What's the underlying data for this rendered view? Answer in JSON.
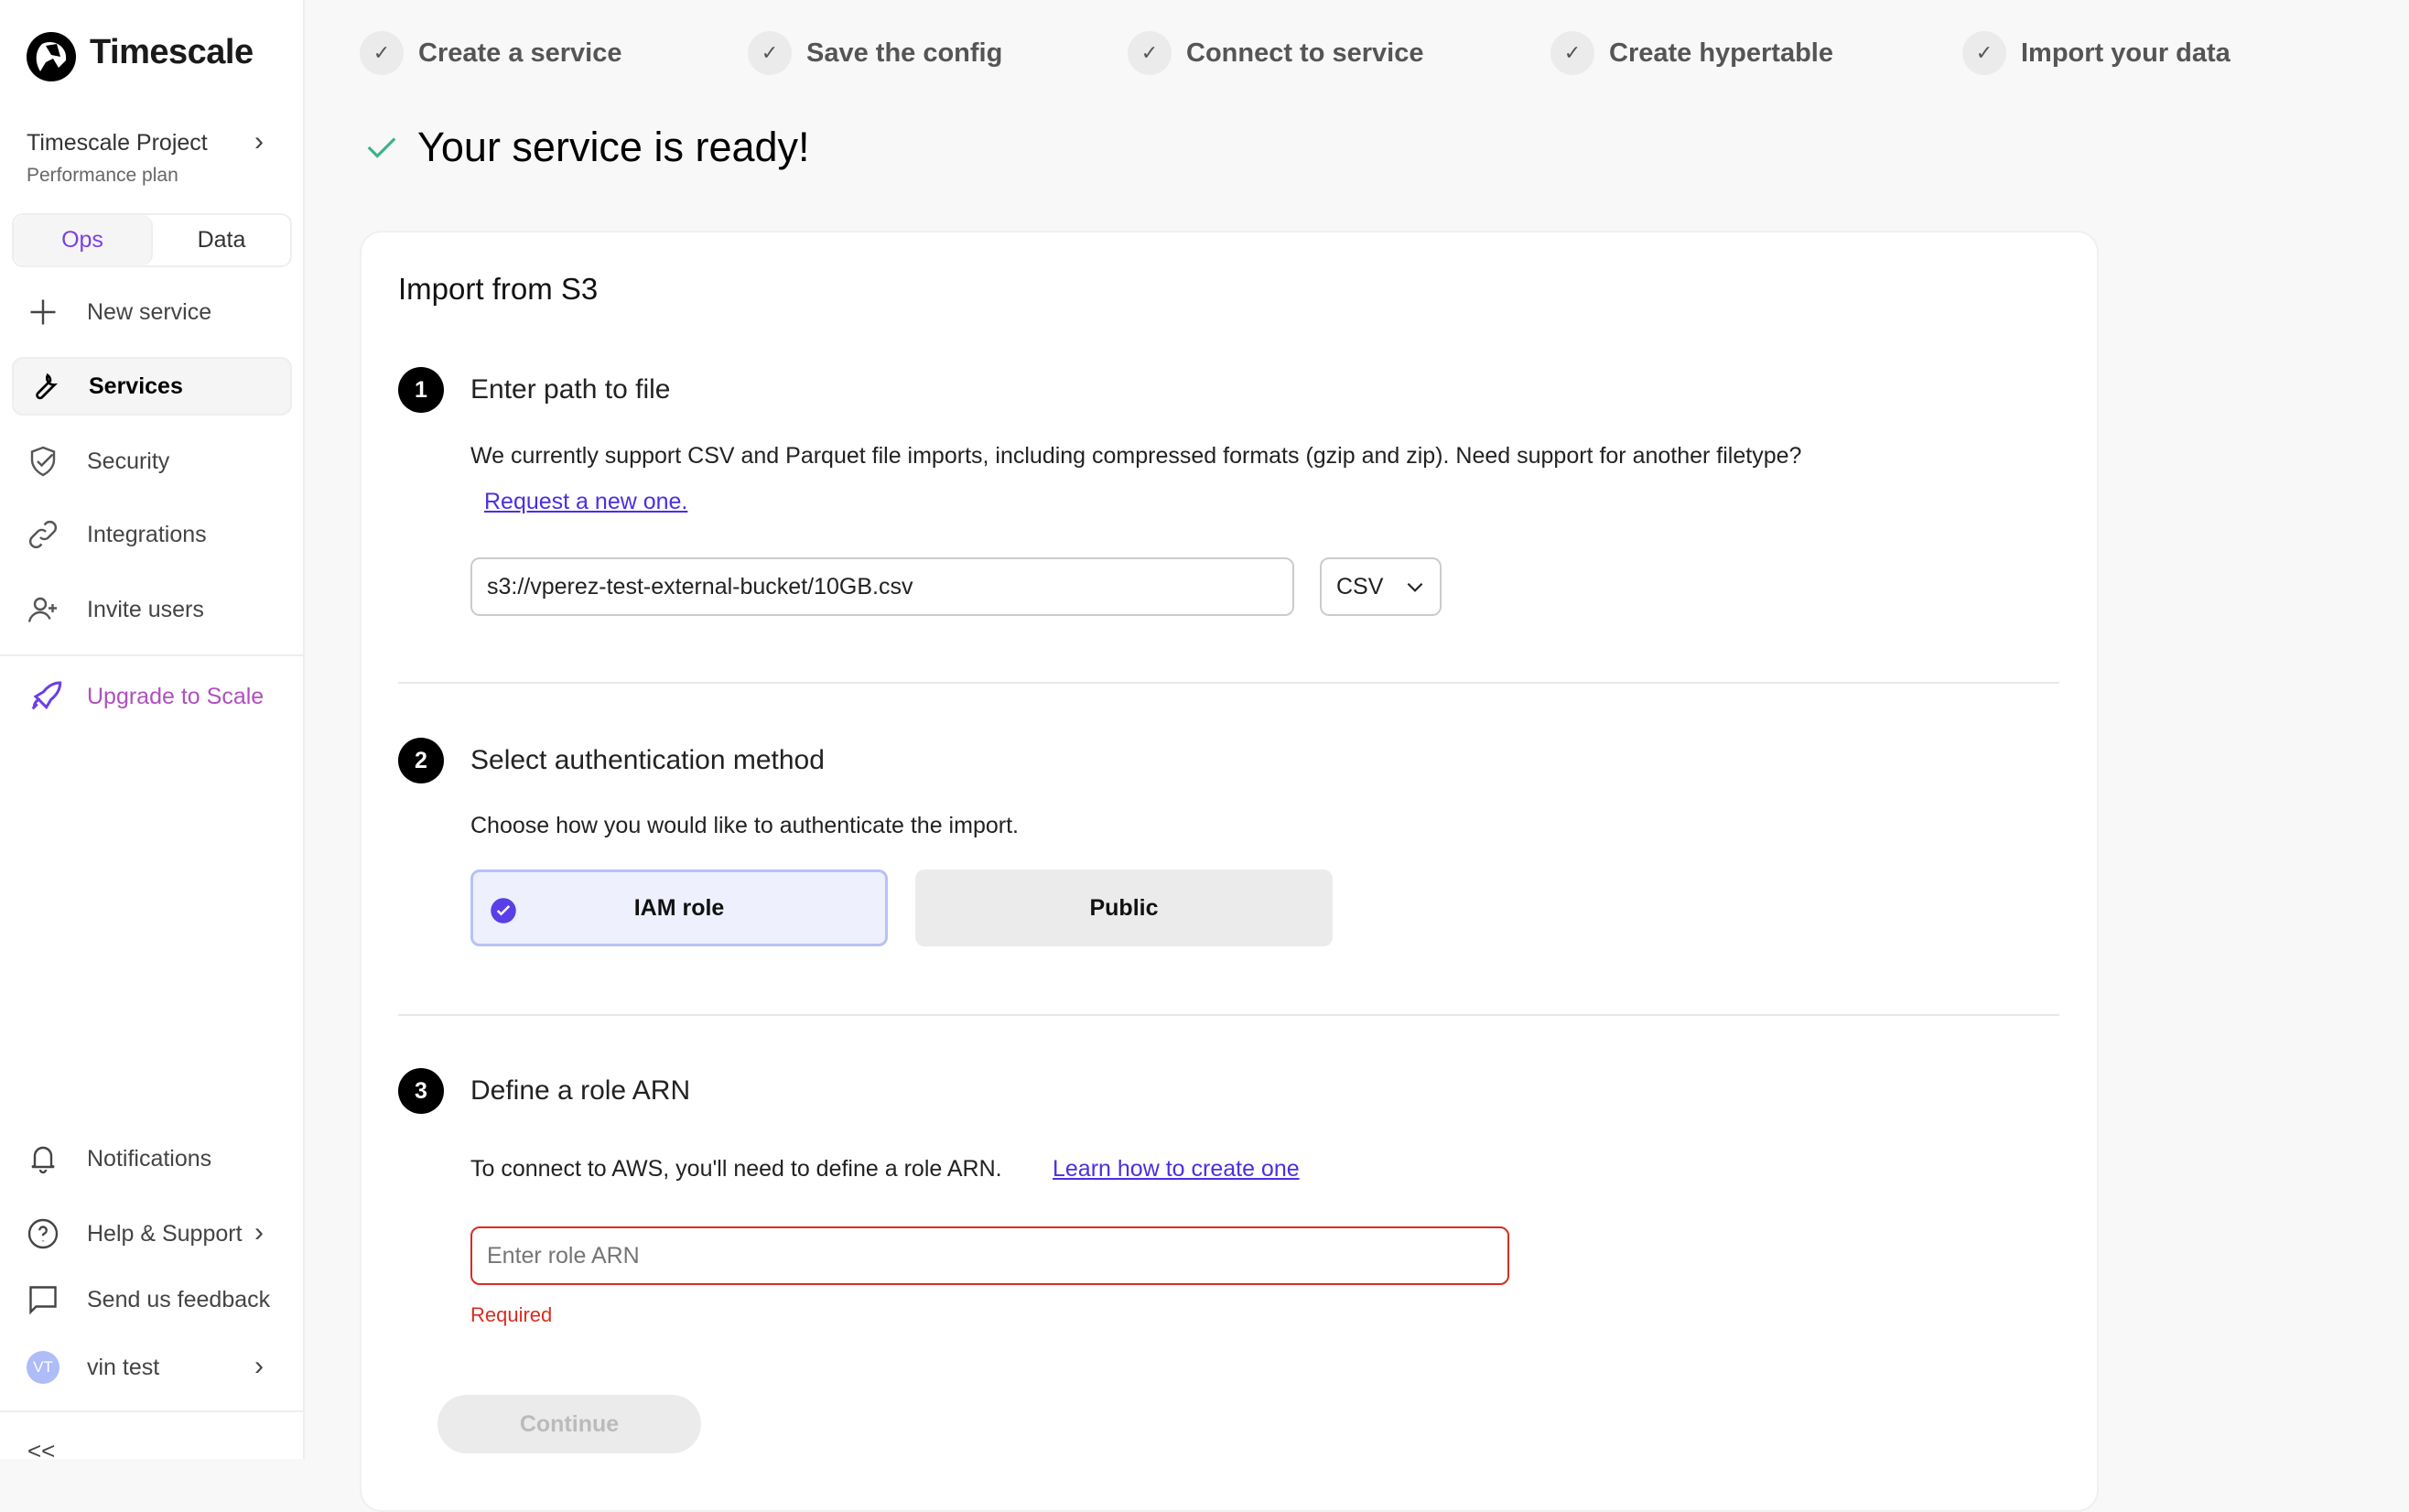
{
  "sidebar": {
    "brand": "Timescale",
    "project": {
      "title": "Timescale Project",
      "plan": "Performance plan"
    },
    "tabs": [
      {
        "label": "Ops",
        "active": true
      },
      {
        "label": "Data",
        "active": false
      }
    ],
    "items": [
      {
        "label": "New service",
        "icon": "plus-icon"
      },
      {
        "label": "Services",
        "icon": "wrench-icon",
        "active": true
      },
      {
        "label": "Security",
        "icon": "shield-check-icon"
      },
      {
        "label": "Integrations",
        "icon": "link-icon"
      },
      {
        "label": "Invite users",
        "icon": "user-plus-icon"
      }
    ],
    "upgrade": "Upgrade to Scale",
    "bottom": [
      {
        "label": "Notifications",
        "icon": "bell-icon"
      },
      {
        "label": "Help & Support",
        "icon": "help-circle-icon"
      },
      {
        "label": "Send us feedback",
        "icon": "message-icon"
      }
    ],
    "user": {
      "initials": "VT",
      "name": "vin test"
    },
    "collapse": "<<"
  },
  "steps": [
    {
      "label": "Create a service"
    },
    {
      "label": "Save the config"
    },
    {
      "label": "Connect to service"
    },
    {
      "label": "Create hypertable"
    },
    {
      "label": "Import your data"
    }
  ],
  "ready_title": "Your service is ready!",
  "card": {
    "title": "Import from S3",
    "s1": {
      "num": "1",
      "title": "Enter path to file",
      "desc": "We currently support CSV and Parquet file imports, including compressed formats (gzip and zip). Need support for another filetype?",
      "link": "Request a new one.",
      "path_value": "s3://vperez-test-external-bucket/10GB.csv",
      "format": "CSV"
    },
    "s2": {
      "num": "2",
      "title": "Select authentication method",
      "desc": "Choose how you would like to authenticate the import.",
      "options": [
        {
          "label": "IAM role",
          "selected": true
        },
        {
          "label": "Public",
          "selected": false
        }
      ]
    },
    "s3": {
      "num": "3",
      "title": "Define a role ARN",
      "desc": "To connect to AWS, you'll need to define a role ARN.",
      "link": "Learn how to create one",
      "placeholder": "Enter role ARN",
      "error": "Required"
    },
    "continue": "Continue"
  },
  "colors": {
    "accent": "#7b3fe4",
    "success": "#3bb38a",
    "error": "#d92d20",
    "link": "#4b2fe0"
  }
}
